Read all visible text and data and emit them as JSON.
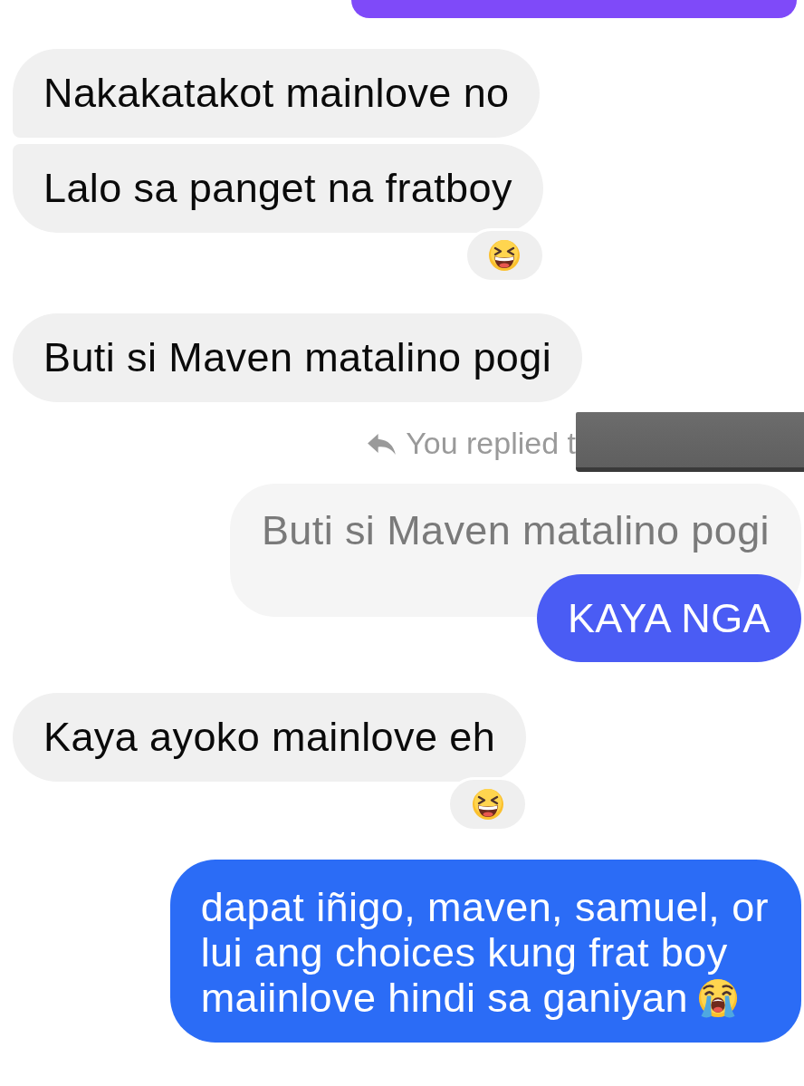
{
  "messages": [
    {
      "kind": "outgoing_cut",
      "color": "#7f4af9"
    },
    {
      "kind": "incoming",
      "grouped_with_previous": false,
      "grouped_with_next": true,
      "text": "Nakakatakot mainlove no",
      "reaction": false
    },
    {
      "kind": "incoming",
      "grouped_with_previous": true,
      "grouped_with_next": false,
      "text": "Lalo sa panget na fratboy",
      "reaction": true
    },
    {
      "kind": "incoming",
      "grouped_with_previous": false,
      "grouped_with_next": false,
      "text": "Buti si Maven matalino pogi",
      "reaction": false
    },
    {
      "kind": "reply",
      "header": "You replied t",
      "redacted": true,
      "quote": "Buti si Maven matalino pogi",
      "text": "KAYA NGA",
      "color": "#4a5cf4"
    },
    {
      "kind": "incoming",
      "grouped_with_previous": false,
      "grouped_with_next": false,
      "text": "Kaya ayoko mainlove eh",
      "reaction": true
    },
    {
      "kind": "outgoing",
      "text": "dapat iñigo, maven, samuel, or\nlui ang choices kung frat boy\nmaiinlove hindi sa ganiyan",
      "trailing_emoji": true,
      "color": "#2b6cf6"
    }
  ]
}
